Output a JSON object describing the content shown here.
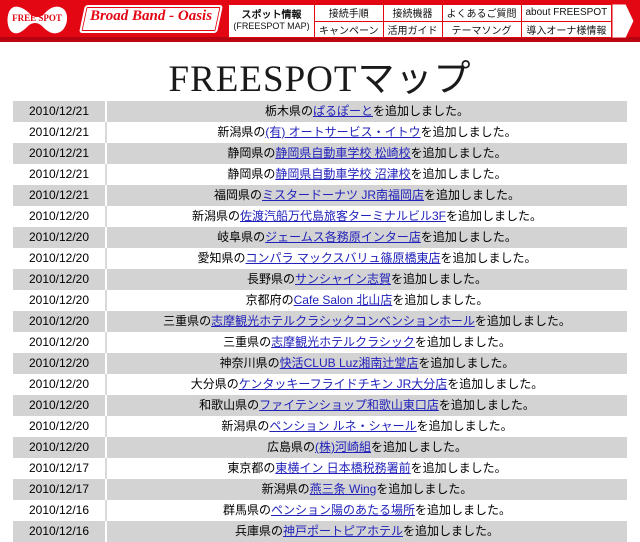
{
  "header": {
    "logo_text": "FREE SPOT",
    "banner_text": "Broad Band - Oasis",
    "nav": {
      "spot_info_line1": "スポット情報",
      "spot_info_line2": "(FREESPOT MAP)",
      "items": [
        {
          "top": "接続手順",
          "bottom": "キャンペーン"
        },
        {
          "top": "接続機器",
          "bottom": "活用ガイド"
        },
        {
          "top": "よくあるご質問",
          "bottom": "テーマソング"
        },
        {
          "top": "about FREESPOT",
          "bottom": "導入オーナ様情報"
        }
      ]
    },
    "accent_color": "#e30613"
  },
  "page_title": "FREESPOTマップ",
  "list": {
    "link_color": "#2222bb",
    "rows": [
      {
        "date": "2010/12/21",
        "prefix": "栃木県の",
        "link": "ぱるぽーと",
        "suffix": "を追加しました。"
      },
      {
        "date": "2010/12/21",
        "prefix": "新潟県の",
        "link": "(有) オートサービス・イトウ",
        "suffix": "を追加しました。"
      },
      {
        "date": "2010/12/21",
        "prefix": "静岡県の",
        "link": "静岡県自動車学校 松崎校",
        "suffix": "を追加しました。"
      },
      {
        "date": "2010/12/21",
        "prefix": "静岡県の",
        "link": "静岡県自動車学校 沼津校",
        "suffix": "を追加しました。"
      },
      {
        "date": "2010/12/21",
        "prefix": "福岡県の",
        "link": "ミスタードーナツ JR南福岡店",
        "suffix": "を追加しました。"
      },
      {
        "date": "2010/12/20",
        "prefix": "新潟県の",
        "link": "佐渡汽船万代島旅客ターミナルビル3F",
        "suffix": "を追加しました。"
      },
      {
        "date": "2010/12/20",
        "prefix": "岐阜県の",
        "link": "ジェームス各務原インター店",
        "suffix": "を追加しました。"
      },
      {
        "date": "2010/12/20",
        "prefix": "愛知県の",
        "link": "コンパラ マックスバリュ篠原橋東店",
        "suffix": "を追加しました。"
      },
      {
        "date": "2010/12/20",
        "prefix": "長野県の",
        "link": "サンシャイン志賀",
        "suffix": "を追加しました。"
      },
      {
        "date": "2010/12/20",
        "prefix": "京都府の",
        "link": "Cafe Salon 北山店",
        "suffix": "を追加しました。"
      },
      {
        "date": "2010/12/20",
        "prefix": "三重県の",
        "link": "志摩観光ホテルクラシックコンベンションホール",
        "suffix": "を追加しました。"
      },
      {
        "date": "2010/12/20",
        "prefix": "三重県の",
        "link": "志摩観光ホテルクラシック",
        "suffix": "を追加しました。"
      },
      {
        "date": "2010/12/20",
        "prefix": "神奈川県の",
        "link": "快活CLUB Luz湘南辻堂店",
        "suffix": "を追加しました。"
      },
      {
        "date": "2010/12/20",
        "prefix": "大分県の",
        "link": "ケンタッキーフライドチキン JR大分店",
        "suffix": "を追加しました。"
      },
      {
        "date": "2010/12/20",
        "prefix": "和歌山県の",
        "link": "ファイテンショップ和歌山東口店",
        "suffix": "を追加しました。"
      },
      {
        "date": "2010/12/20",
        "prefix": "新潟県の",
        "link": "ペンション ルネ・シャール",
        "suffix": "を追加しました。"
      },
      {
        "date": "2010/12/20",
        "prefix": "広島県の",
        "link": "(株)河崎組",
        "suffix": "を追加しました。"
      },
      {
        "date": "2010/12/17",
        "prefix": "東京都の",
        "link": "東横イン 日本橋税務署前",
        "suffix": "を追加しました。"
      },
      {
        "date": "2010/12/17",
        "prefix": "新潟県の",
        "link": "燕三条 Wing",
        "suffix": "を追加しました。"
      },
      {
        "date": "2010/12/16",
        "prefix": "群馬県の",
        "link": "ペンション陽のあたる場所",
        "suffix": "を追加しました。"
      },
      {
        "date": "2010/12/16",
        "prefix": "兵庫県の",
        "link": "神戸ポートピアホテル",
        "suffix": "を追加しました。"
      }
    ]
  }
}
